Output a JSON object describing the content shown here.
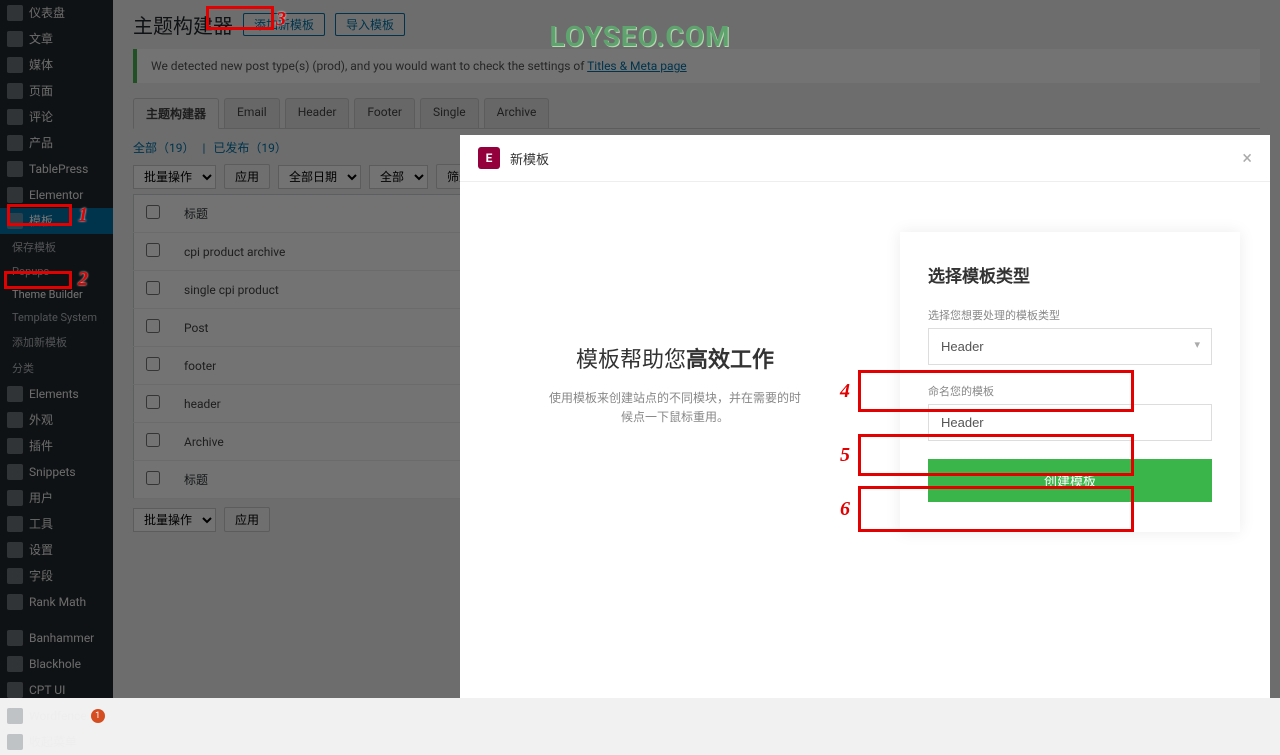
{
  "watermark": "LOYSEO.COM",
  "sidebar": {
    "items": [
      {
        "label": "仪表盘",
        "icon": "dashboard"
      },
      {
        "label": "文章",
        "icon": "pin"
      },
      {
        "label": "媒体",
        "icon": "media"
      },
      {
        "label": "页面",
        "icon": "page"
      },
      {
        "label": "评论",
        "icon": "comment"
      },
      {
        "label": "产品",
        "icon": "product"
      },
      {
        "label": "TablePress",
        "icon": "table"
      },
      {
        "label": "Elementor",
        "icon": "elementor"
      },
      {
        "label": "模板",
        "icon": "template",
        "current": true
      },
      {
        "label": "Elements",
        "icon": "elements"
      },
      {
        "label": "外观",
        "icon": "appearance"
      },
      {
        "label": "插件",
        "icon": "plugins"
      },
      {
        "label": "Snippets",
        "icon": "snippets"
      },
      {
        "label": "用户",
        "icon": "users"
      },
      {
        "label": "工具",
        "icon": "tools"
      },
      {
        "label": "设置",
        "icon": "settings"
      },
      {
        "label": "字段",
        "icon": "fields"
      },
      {
        "label": "Rank Math",
        "icon": "rankmath"
      },
      {
        "label": "Banhammer",
        "icon": "banhammer"
      },
      {
        "label": "Blackhole",
        "icon": "blackhole"
      },
      {
        "label": "CPT UI",
        "icon": "cptui"
      },
      {
        "label": "Wordfence",
        "icon": "wordfence",
        "badge": "1"
      },
      {
        "label": "收起菜单",
        "icon": "collapse"
      }
    ],
    "subitems": [
      {
        "label": "保存模板"
      },
      {
        "label": "Popups"
      },
      {
        "label": "Theme Builder",
        "active": true
      },
      {
        "label": "Template System"
      },
      {
        "label": "添加新模板"
      },
      {
        "label": "分类"
      }
    ]
  },
  "main": {
    "title": "主题构建器",
    "add_new": "添加新模板",
    "import": "导入模板",
    "notice_text": "We detected new post type(s) (prod), and you would want to check the settings of ",
    "notice_link": "Titles & Meta page",
    "tabs": [
      "主题构建器",
      "Email",
      "Header",
      "Footer",
      "Single",
      "Archive"
    ],
    "filter_all": "全部（19）",
    "filter_sep": "|",
    "filter_pub": "已发布（19）",
    "bulk_action": "批量操作",
    "apply": "应用",
    "all_dates": "全部日期",
    "all": "全部",
    "filter_btn": "筛选",
    "col_title": "标题",
    "rows": [
      "cpi product archive",
      "single cpi product",
      "Post",
      "footer",
      "header",
      "Archive"
    ]
  },
  "modal": {
    "title": "新模板",
    "left_heading_1": "模板帮助您",
    "left_heading_2": "高效工作",
    "left_desc": "使用模板来创建站点的不同模块，并在需要的时候点一下鼠标重用。",
    "card_title": "选择模板类型",
    "type_label": "选择您想要处理的模板类型",
    "type_value": "Header",
    "name_label": "命名您的模板",
    "name_value": "Header",
    "create_btn": "创建模板"
  },
  "annotations": {
    "n1": "1",
    "n2": "2",
    "n3": "3",
    "n4": "4",
    "n5": "5",
    "n6": "6"
  }
}
